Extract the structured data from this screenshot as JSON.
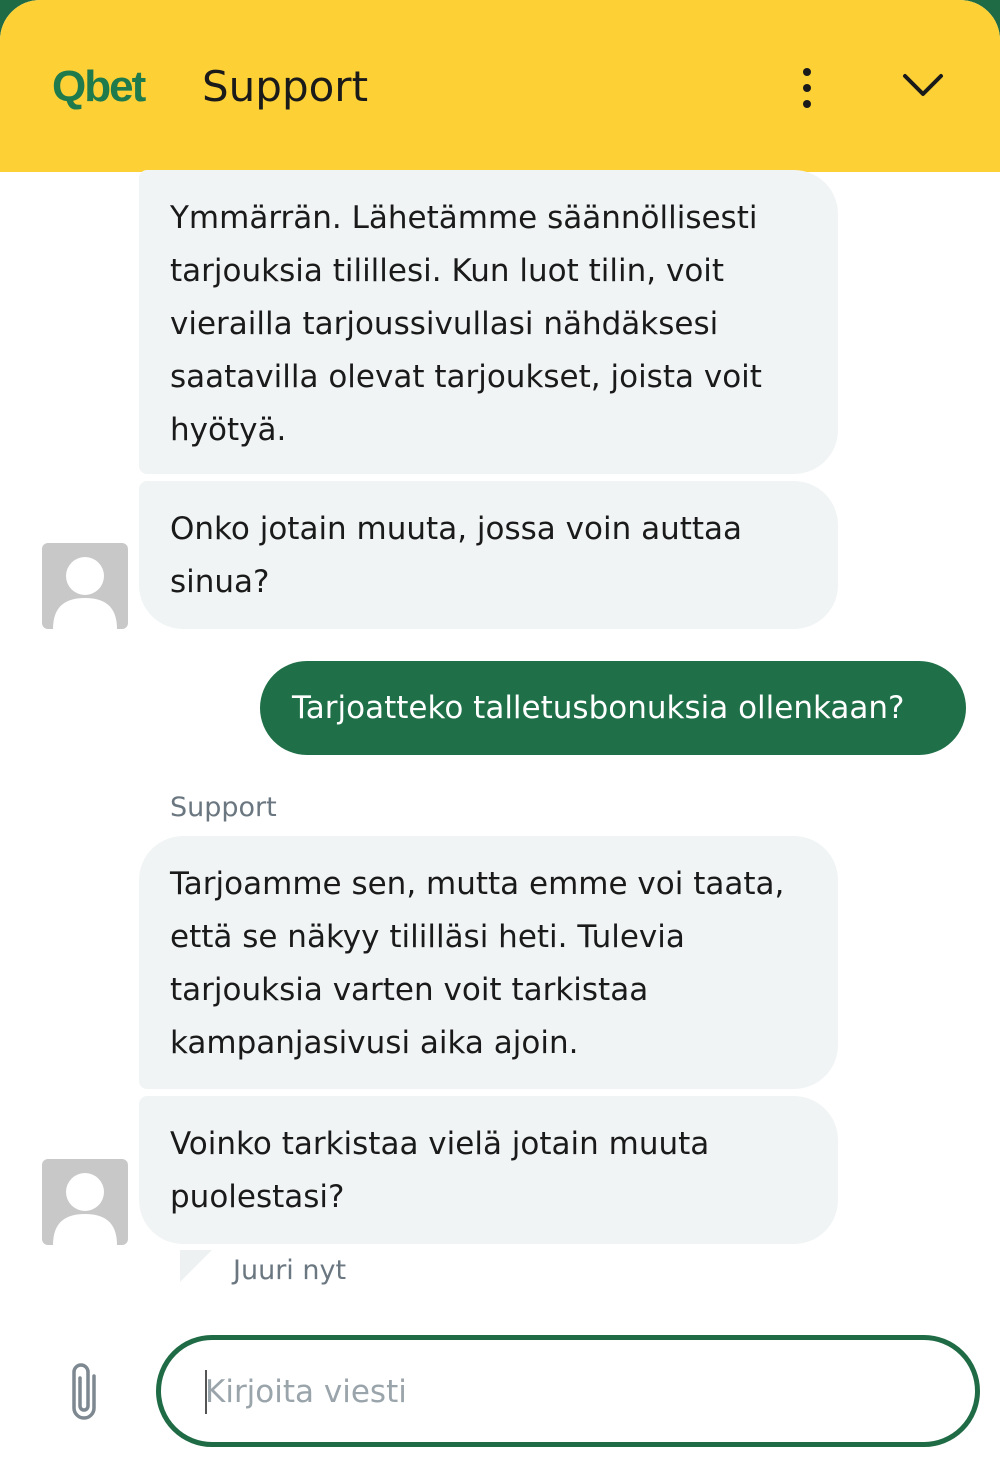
{
  "header": {
    "logo": "Qbet",
    "title": "Support",
    "menu_icon": "vertical-dots-icon",
    "collapse_icon": "chevron-down-icon"
  },
  "messages": [
    {
      "from": "agent",
      "text": "Ymmärrän. Lähetämme säännöllisesti tarjouksia tilillesi. Kun luot tilin, voit vierailla tarjoussivullasi nähdäksesi saatavilla olevat tarjoukset, joista voit hyötyä."
    },
    {
      "from": "agent",
      "text": "Onko jotain muuta, jossa voin auttaa sinua?"
    },
    {
      "from": "user",
      "text": "Tarjoatteko talletusbonuksia ollenkaan?"
    },
    {
      "from": "agent",
      "sender": "Support",
      "text": "Tarjoamme sen, mutta emme voi taata, että se näkyy tililläsi heti. Tulevia tarjouksia varten voit tarkistaa kampanjasivusi aika ajoin."
    },
    {
      "from": "agent",
      "text": "Voinko tarkistaa vielä jotain muuta puolestasi?"
    }
  ],
  "timestamp": "Juuri nyt",
  "composer": {
    "placeholder": "Kirjoita viesti",
    "attach_icon": "paperclip-icon"
  },
  "colors": {
    "header_bg": "#fdd036",
    "brand_green": "#1f7048",
    "agent_bubble": "#f1f4f5"
  }
}
